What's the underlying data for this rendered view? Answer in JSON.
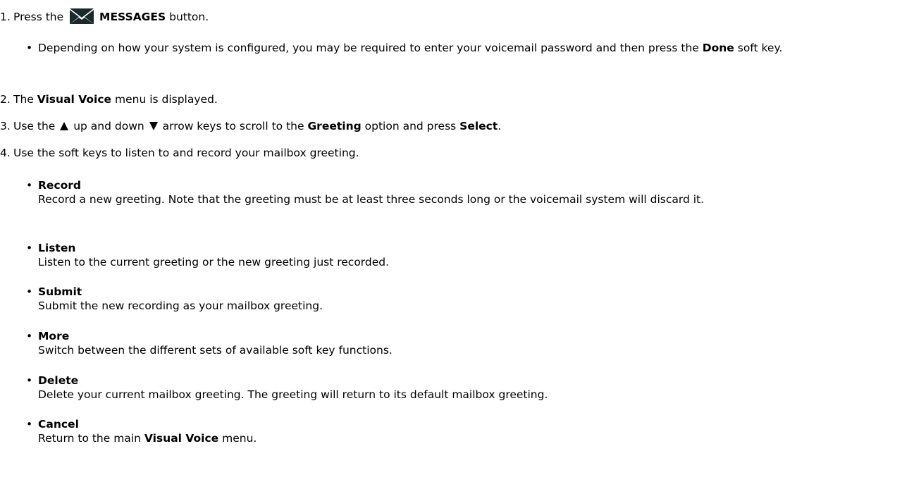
{
  "steps": [
    {
      "num": "1.",
      "pre": "Press the",
      "bold": "MESSAGES",
      "post": "button."
    },
    {
      "num": "2.",
      "pre": "The",
      "bold": "Visual Voice",
      "post": "menu is displayed."
    },
    {
      "num": "3.",
      "pre": "Use the",
      "mid1": "up and down",
      "mid2": "arrow keys to scroll to the",
      "bold1": "Greeting",
      "mid3": "option and press",
      "bold2": "Select",
      "post": "."
    },
    {
      "num": "4.",
      "text": "Use the soft keys to listen to and record your mailbox greeting."
    }
  ],
  "step1_note": {
    "pre": "Depending on how your system is configured, you may be required to enter your voicemail password and then press the",
    "bold": "Done",
    "post": "soft key."
  },
  "softkeys": [
    {
      "name": "Record",
      "desc": "Record a new greeting. Note that the greeting must be at least three seconds long or the voicemail system will discard it."
    },
    {
      "name": "Listen",
      "desc": "Listen to the current greeting or the new greeting just recorded."
    },
    {
      "name": "Submit",
      "desc": "Submit the new recording as your mailbox greeting."
    },
    {
      "name": "More",
      "desc": "Switch between the different sets of available soft key functions."
    },
    {
      "name": "Delete",
      "desc": "Delete your current mailbox greeting. The greeting will return to its default mailbox greeting."
    },
    {
      "name": "Cancel",
      "desc_pre": "Return to the main",
      "desc_bold": "Visual Voice",
      "desc_post": "menu."
    }
  ],
  "bullet_char": "•",
  "icons": {
    "messages": "envelope-icon",
    "up": "up-arrow-icon",
    "down": "down-arrow-icon"
  }
}
